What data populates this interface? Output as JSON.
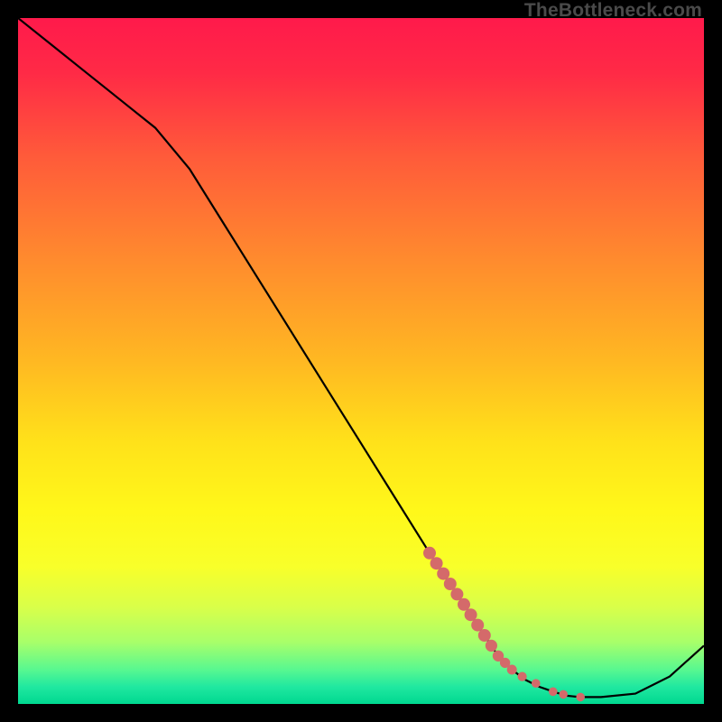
{
  "watermark": "TheBottleneck.com",
  "chart_data": {
    "type": "line",
    "title": "",
    "xlabel": "",
    "ylabel": "",
    "xlim": [
      0,
      100
    ],
    "ylim": [
      0,
      100
    ],
    "grid": false,
    "legend": false,
    "series": [
      {
        "name": "curve",
        "color": "#000000",
        "x": [
          0,
          5,
          10,
          15,
          20,
          25,
          30,
          35,
          40,
          45,
          50,
          55,
          60,
          62,
          64,
          66,
          68,
          70,
          72,
          74,
          76,
          78,
          80,
          82,
          85,
          90,
          95,
          100
        ],
        "y": [
          100,
          96,
          92,
          88,
          84,
          78,
          70,
          62,
          54,
          46,
          38,
          30,
          22,
          19,
          16,
          13,
          10,
          7,
          5,
          3.5,
          2.5,
          1.8,
          1.2,
          1,
          1,
          1.5,
          4,
          8.5
        ]
      }
    ],
    "markers": {
      "name": "highlight-dots",
      "color": "#d46a6a",
      "points": [
        {
          "x": 60,
          "y": 22,
          "r": 3.2
        },
        {
          "x": 61,
          "y": 20.5,
          "r": 3.2
        },
        {
          "x": 62,
          "y": 19,
          "r": 3.2
        },
        {
          "x": 63,
          "y": 17.5,
          "r": 3.2
        },
        {
          "x": 64,
          "y": 16,
          "r": 3.2
        },
        {
          "x": 65,
          "y": 14.5,
          "r": 3.2
        },
        {
          "x": 66,
          "y": 13,
          "r": 3.2
        },
        {
          "x": 67,
          "y": 11.5,
          "r": 3.2
        },
        {
          "x": 68,
          "y": 10,
          "r": 3.2
        },
        {
          "x": 69,
          "y": 8.5,
          "r": 3.0
        },
        {
          "x": 70,
          "y": 7,
          "r": 2.8
        },
        {
          "x": 71,
          "y": 6,
          "r": 2.6
        },
        {
          "x": 72,
          "y": 5,
          "r": 2.5
        },
        {
          "x": 73.5,
          "y": 4,
          "r": 2.3
        },
        {
          "x": 75.5,
          "y": 3,
          "r": 2.2
        },
        {
          "x": 78,
          "y": 1.8,
          "r": 2.2
        },
        {
          "x": 79.5,
          "y": 1.4,
          "r": 2.2
        },
        {
          "x": 82,
          "y": 1.0,
          "r": 2.2
        }
      ]
    },
    "gradient_stops": [
      {
        "offset": 0,
        "color": "#ff1a4b"
      },
      {
        "offset": 0.08,
        "color": "#ff2a46"
      },
      {
        "offset": 0.2,
        "color": "#ff5a3a"
      },
      {
        "offset": 0.35,
        "color": "#ff8a2e"
      },
      {
        "offset": 0.5,
        "color": "#ffb822"
      },
      {
        "offset": 0.62,
        "color": "#ffe21a"
      },
      {
        "offset": 0.72,
        "color": "#fff81a"
      },
      {
        "offset": 0.8,
        "color": "#f8ff2a"
      },
      {
        "offset": 0.86,
        "color": "#d8ff4a"
      },
      {
        "offset": 0.91,
        "color": "#a8ff6a"
      },
      {
        "offset": 0.95,
        "color": "#58f890"
      },
      {
        "offset": 0.975,
        "color": "#20e8a0"
      },
      {
        "offset": 1.0,
        "color": "#00d890"
      }
    ]
  }
}
